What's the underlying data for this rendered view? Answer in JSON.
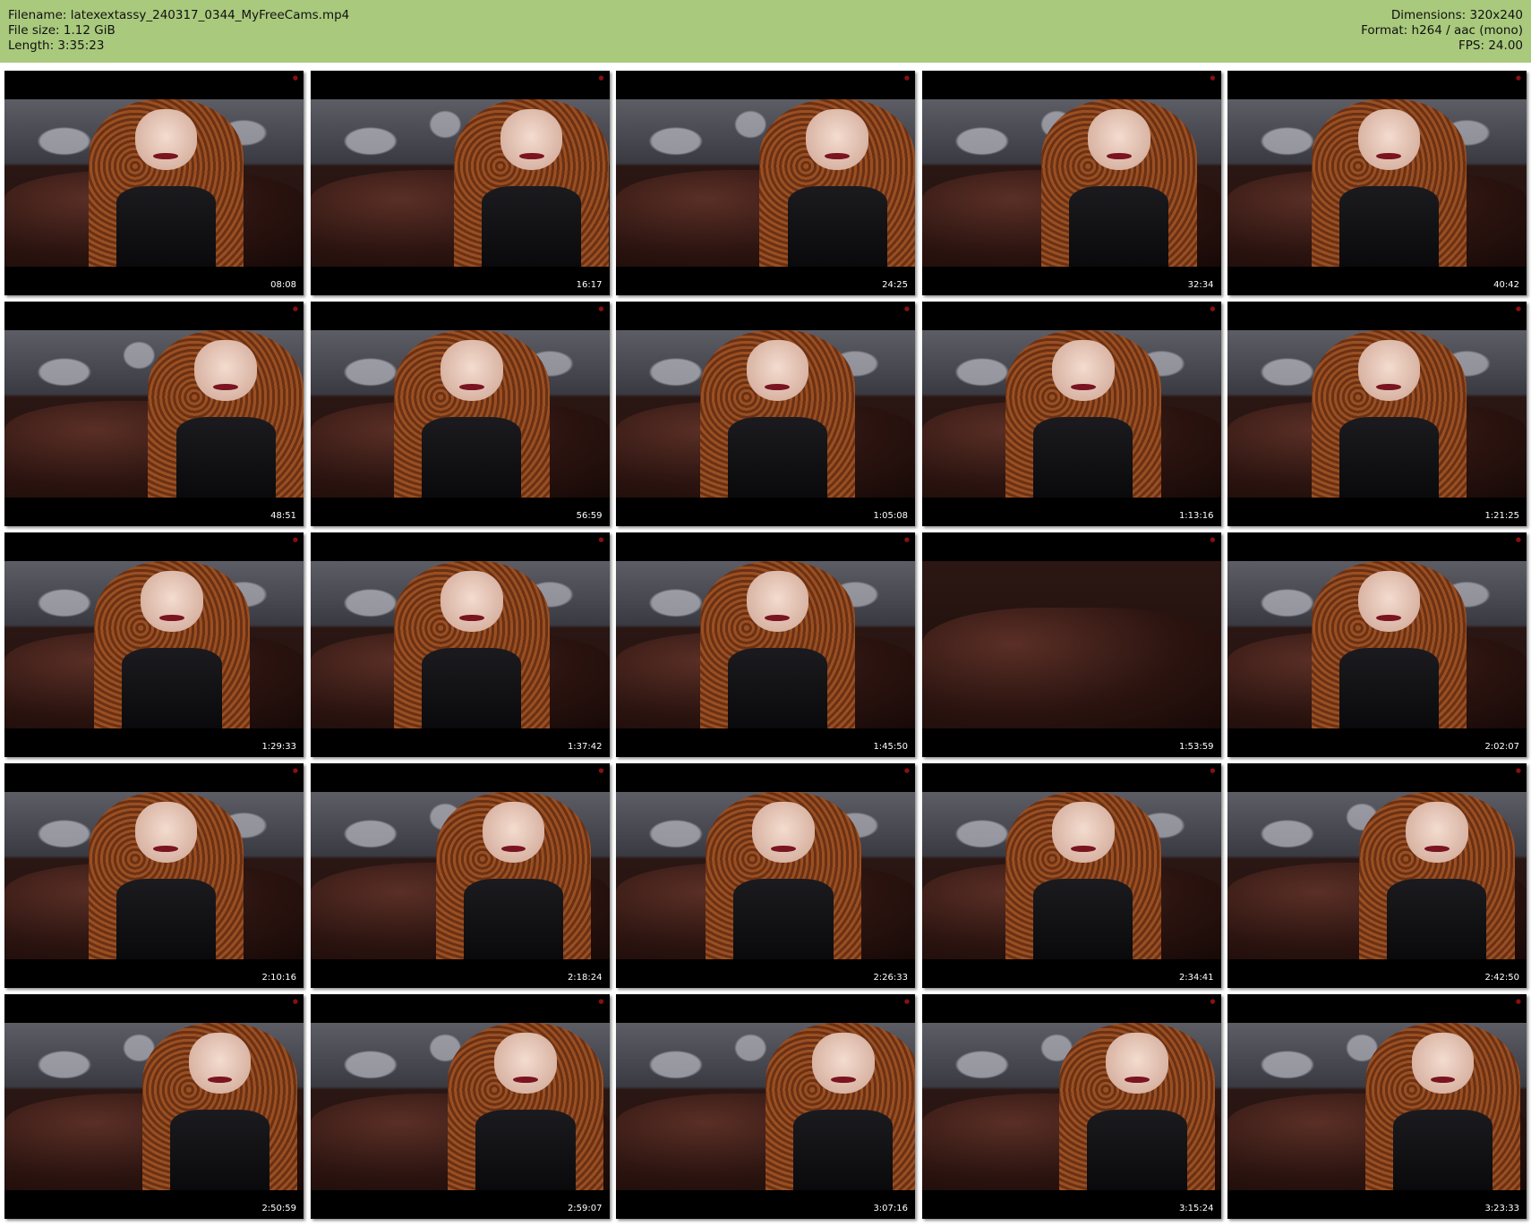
{
  "header": {
    "filename": "Filename: latexextassy_240317_0344_MyFreeCams.mp4",
    "file_size": "File size: 1.12 GiB",
    "length": "Length: 3:35:23",
    "dimensions": "Dimensions: 320x240",
    "format": "Format: h264 / aac (mono)",
    "fps": "FPS: 24.00",
    "background_color": "#a9c97d"
  },
  "thumbnails": [
    {
      "timestamp": "08:08"
    },
    {
      "timestamp": "16:17"
    },
    {
      "timestamp": "24:25"
    },
    {
      "timestamp": "32:34"
    },
    {
      "timestamp": "40:42"
    },
    {
      "timestamp": "48:51"
    },
    {
      "timestamp": "56:59"
    },
    {
      "timestamp": "1:05:08"
    },
    {
      "timestamp": "1:13:16"
    },
    {
      "timestamp": "1:21:25"
    },
    {
      "timestamp": "1:29:33"
    },
    {
      "timestamp": "1:37:42"
    },
    {
      "timestamp": "1:45:50"
    },
    {
      "timestamp": "1:53:59"
    },
    {
      "timestamp": "2:02:07"
    },
    {
      "timestamp": "2:10:16"
    },
    {
      "timestamp": "2:18:24"
    },
    {
      "timestamp": "2:26:33"
    },
    {
      "timestamp": "2:34:41"
    },
    {
      "timestamp": "2:42:50"
    },
    {
      "timestamp": "2:50:59"
    },
    {
      "timestamp": "2:59:07"
    },
    {
      "timestamp": "3:07:16"
    },
    {
      "timestamp": "3:15:24"
    },
    {
      "timestamp": "3:23:33"
    }
  ]
}
